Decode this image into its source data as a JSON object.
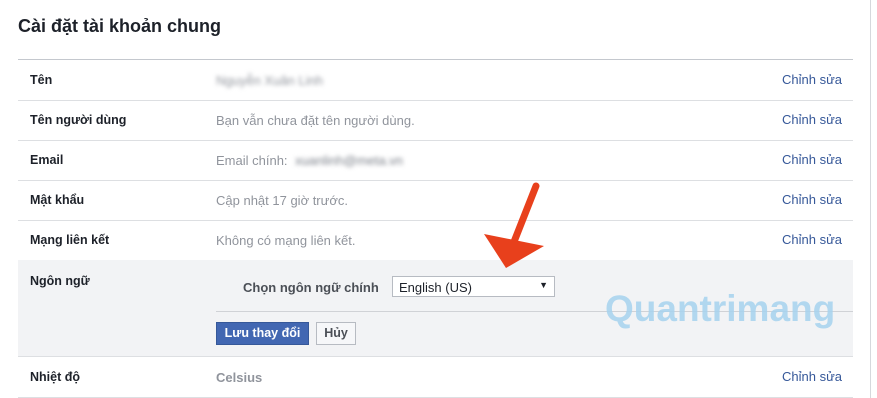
{
  "title": "Cài đặt tài khoản chung",
  "rows": [
    {
      "label": "Tên",
      "value": "Nguyễn Xuân Linh",
      "edit": "Chỉnh sửa"
    },
    {
      "label": "Tên người dùng",
      "value": "Bạn vẫn chưa đặt tên người dùng.",
      "edit": "Chỉnh sửa"
    },
    {
      "label": "Email",
      "value_prefix": "Email chính:",
      "value": "xuanlinh@meta.vn",
      "edit": "Chỉnh sửa"
    },
    {
      "label": "Mật khẩu",
      "value": "Cập nhật 17 giờ trước.",
      "edit": "Chỉnh sửa"
    },
    {
      "label": "Mạng liên kết",
      "value": "Không có mạng liên kết.",
      "edit": "Chỉnh sửa"
    }
  ],
  "language": {
    "label": "Ngôn ngữ",
    "prompt": "Chọn ngôn ngữ chính",
    "selected": "English (US)",
    "save_label": "Lưu thay đổi",
    "cancel_label": "Hủy"
  },
  "temperature": {
    "label": "Nhiệt độ",
    "value": "Celsius",
    "edit": "Chỉnh sửa"
  },
  "watermark": "Quantrimang",
  "colors": {
    "accent": "#4267b2",
    "link": "#365899",
    "arrow": "#e8401c",
    "watermark": "#a6d3ef"
  }
}
